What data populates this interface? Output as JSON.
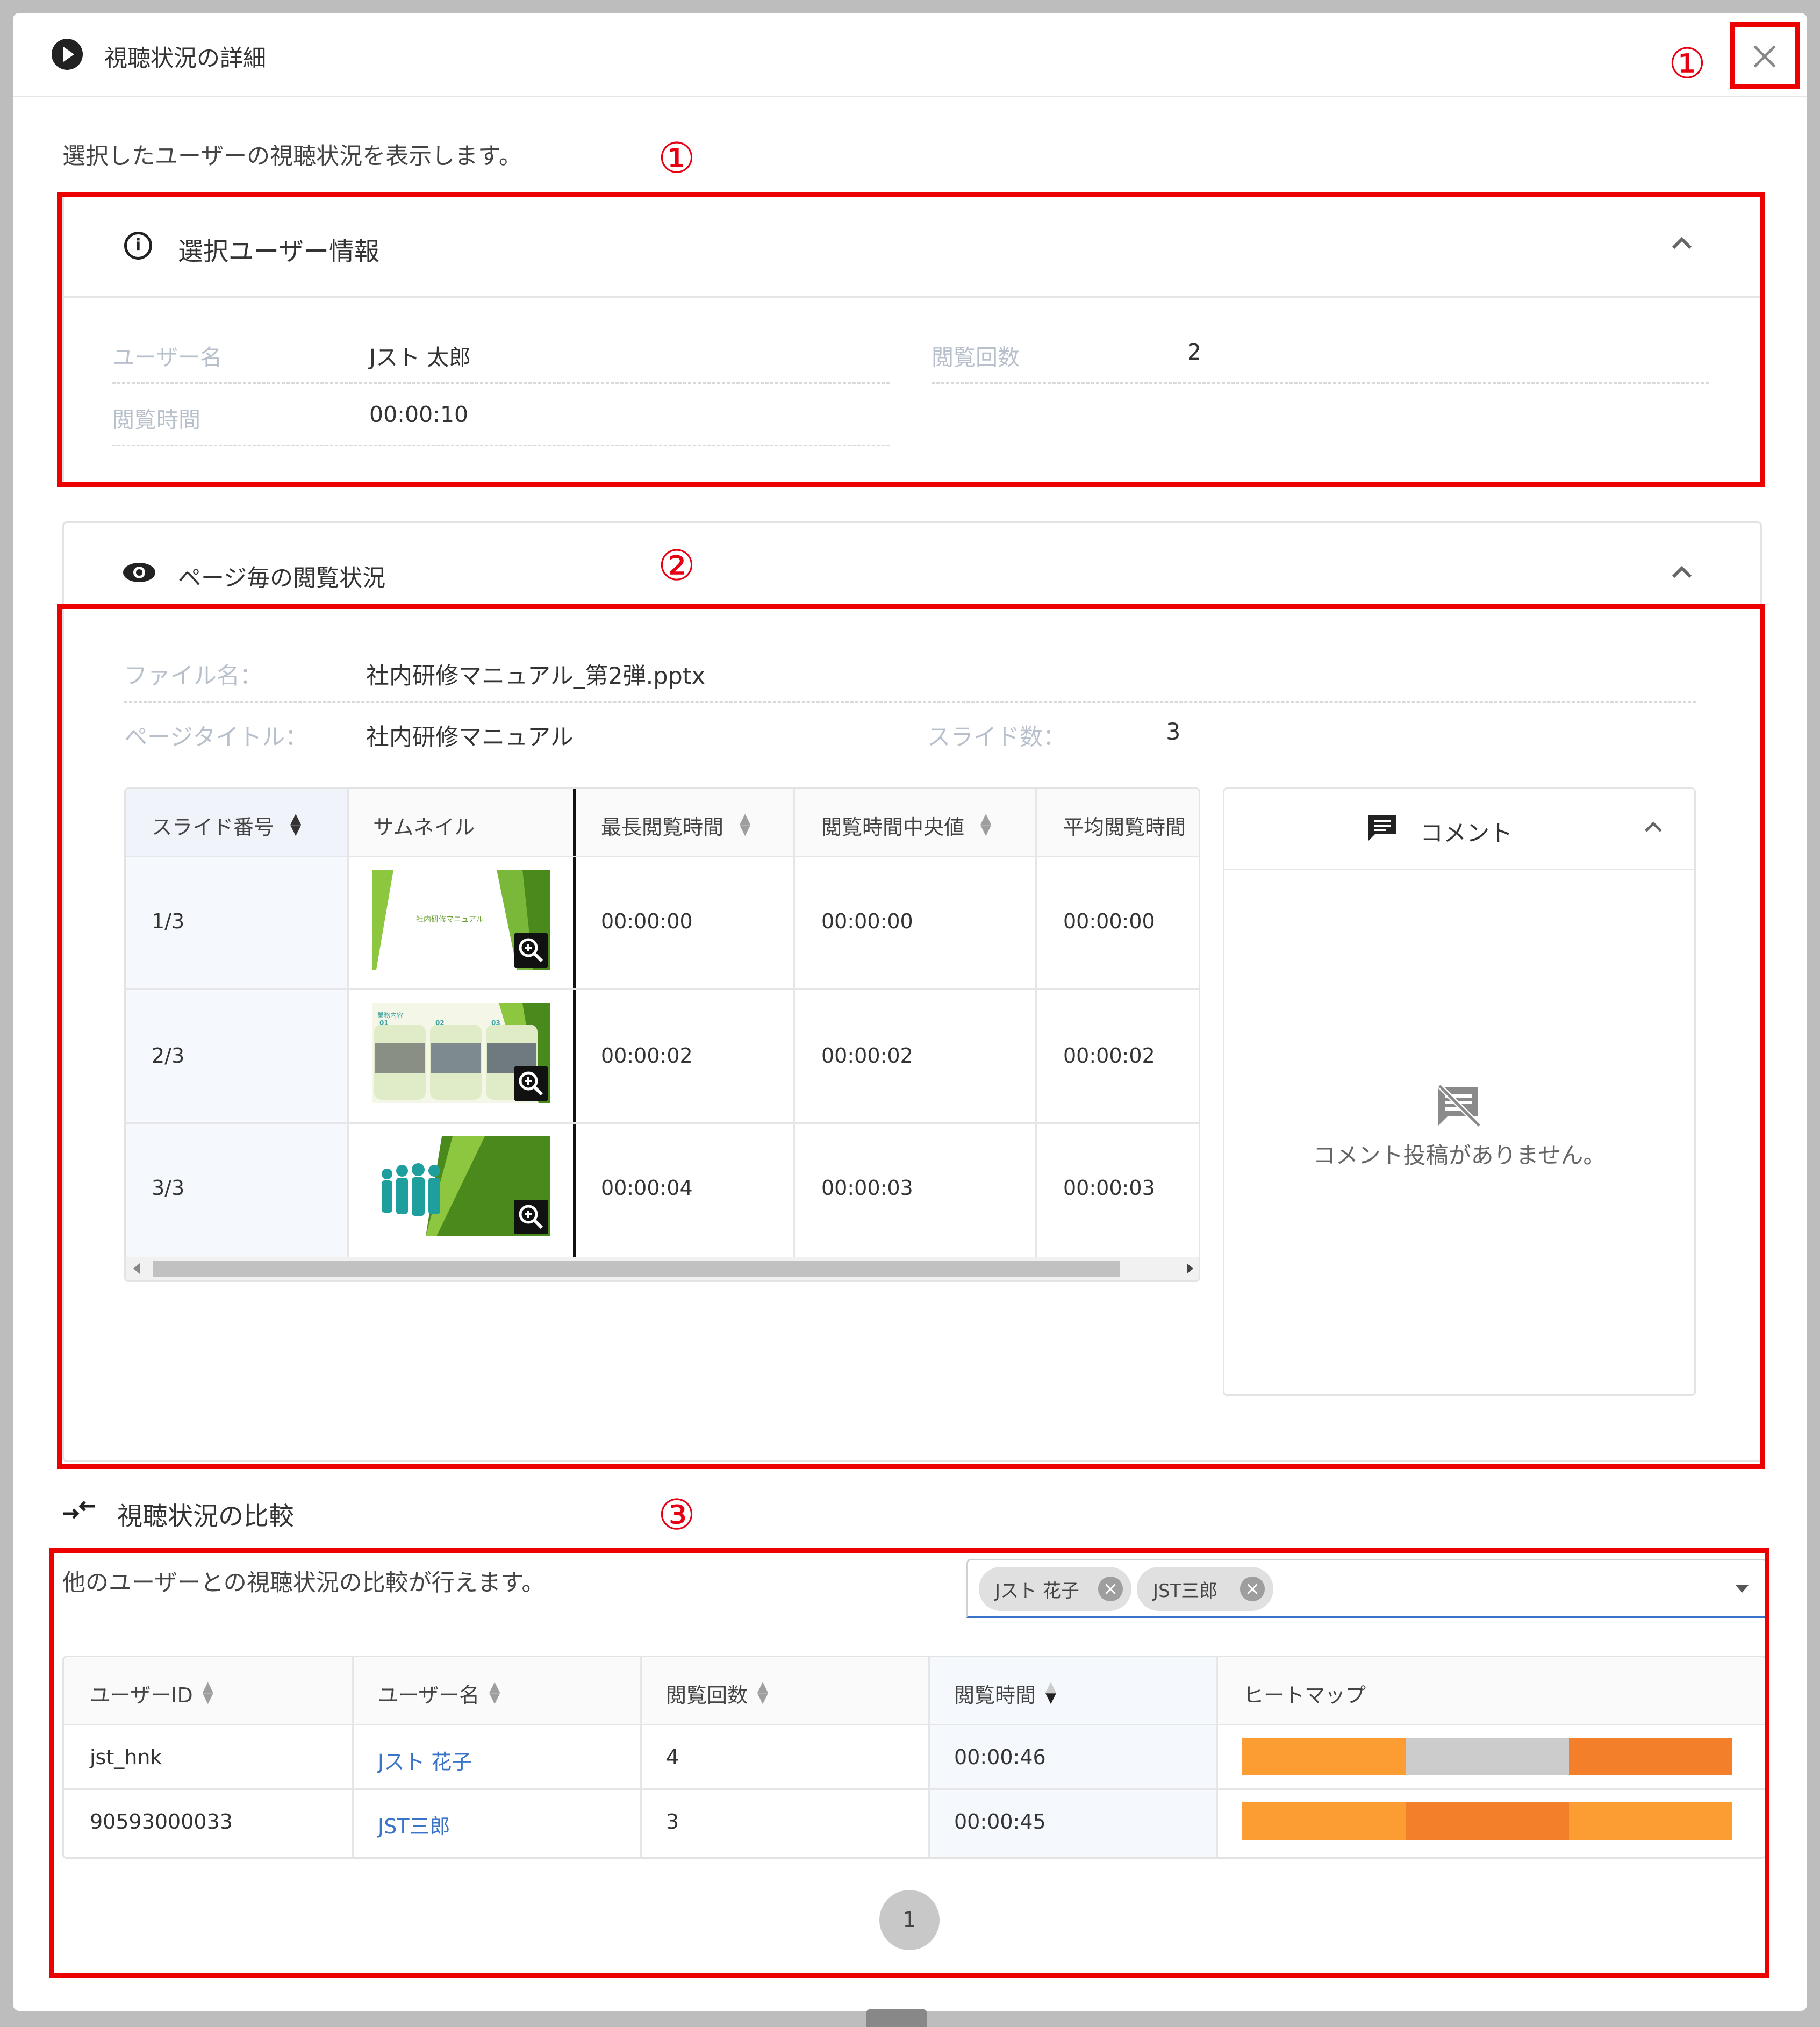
{
  "dialog": {
    "title": "視聴状況の詳細",
    "description": "選択したユーザーの視聴状況を表示します。"
  },
  "annotations": {
    "close_marker": "①",
    "section1_marker": "①",
    "section2_marker": "②",
    "section3_marker": "③"
  },
  "user_info": {
    "heading": "選択ユーザー情報",
    "username_label": "ユーザー名",
    "username_value": "Jスト 太郎",
    "view_count_label": "閲覧回数",
    "view_count_value": "2",
    "view_time_label": "閲覧時間",
    "view_time_value": "00:00:10"
  },
  "page_status": {
    "heading": "ページ毎の閲覧状況",
    "file_name_label": "ファイル名：",
    "file_name_value": "社内研修マニュアル_第2弾.pptx",
    "page_title_label": "ページタイトル：",
    "page_title_value": "社内研修マニュアル",
    "slide_count_label": "スライド数：",
    "slide_count_value": "3",
    "table": {
      "headers": [
        "スライド番号",
        "サムネイル",
        "最長閲覧時間",
        "閲覧時間中央値",
        "平均閲覧時間"
      ],
      "rows": [
        {
          "slide": "1/3",
          "thumb_text": "社内研修マニュアル",
          "max": "00:00:00",
          "median": "00:00:00",
          "avg": "00:00:00"
        },
        {
          "slide": "2/3",
          "thumb_text": "業務内容",
          "max": "00:00:02",
          "median": "00:00:02",
          "avg": "00:00:02"
        },
        {
          "slide": "3/3",
          "thumb_text": "",
          "max": "00:00:04",
          "median": "00:00:03",
          "avg": "00:00:03"
        }
      ]
    },
    "thumb2_labels": [
      "01",
      "02",
      "03"
    ],
    "comments": {
      "heading": "コメント",
      "empty": "コメント投稿がありません。"
    }
  },
  "compare": {
    "heading": "視聴状況の比較",
    "description": "他のユーザーとの視聴状況の比較が行えます。",
    "chips": [
      "Jスト 花子",
      "JST三郎"
    ],
    "table": {
      "headers": [
        "ユーザーID",
        "ユーザー名",
        "閲覧回数",
        "閲覧時間",
        "ヒートマップ"
      ],
      "rows": [
        {
          "user_id": "jst_hnk",
          "user_name": "Jスト 花子",
          "views": "4",
          "time": "00:00:46",
          "heatmap": [
            "#fb9d32",
            "#cccccc",
            "#f47f2a"
          ]
        },
        {
          "user_id": "90593000033",
          "user_name": "JST三郎",
          "views": "3",
          "time": "00:00:45",
          "heatmap": [
            "#fb9d32",
            "#f47f2a",
            "#fb9d32"
          ]
        }
      ]
    },
    "pagination": {
      "current_page": "1"
    }
  },
  "colors": {
    "annotation_red": "#e60012",
    "link_blue": "#3a74c9",
    "label_gray": "#b8c0cc"
  }
}
